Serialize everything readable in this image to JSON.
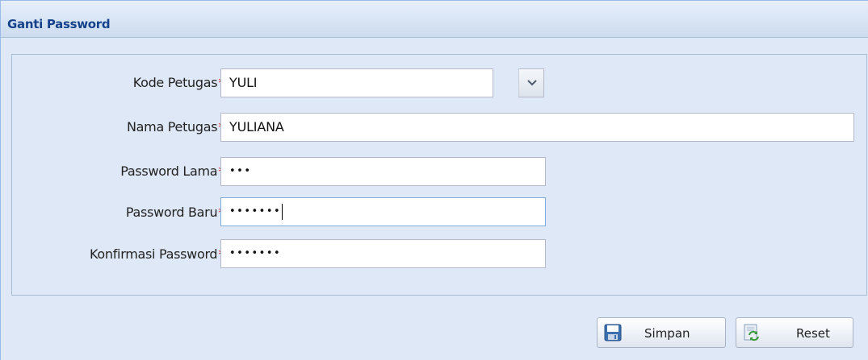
{
  "panel": {
    "title": "Ganti Password"
  },
  "form": {
    "required_marker": "*",
    "fields": {
      "kode_petugas": {
        "label": "Kode Petugas",
        "value": "YULI"
      },
      "nama_petugas": {
        "label": "Nama Petugas",
        "value": "YULIANA"
      },
      "password_lama": {
        "label": "Password Lama",
        "value": "•••"
      },
      "password_baru": {
        "label": "Password Baru",
        "value": "•••••••"
      },
      "konfirmasi_password": {
        "label": "Konfirmasi Password",
        "value": "•••••••"
      }
    }
  },
  "buttons": {
    "save_label": "Simpan",
    "save_icon": "floppy-disk-icon",
    "reset_label": "Reset",
    "reset_icon": "refresh-icon"
  },
  "colors": {
    "title": "#15428b",
    "required": "#e3262b",
    "panel_bg": "#dfe8f6"
  }
}
